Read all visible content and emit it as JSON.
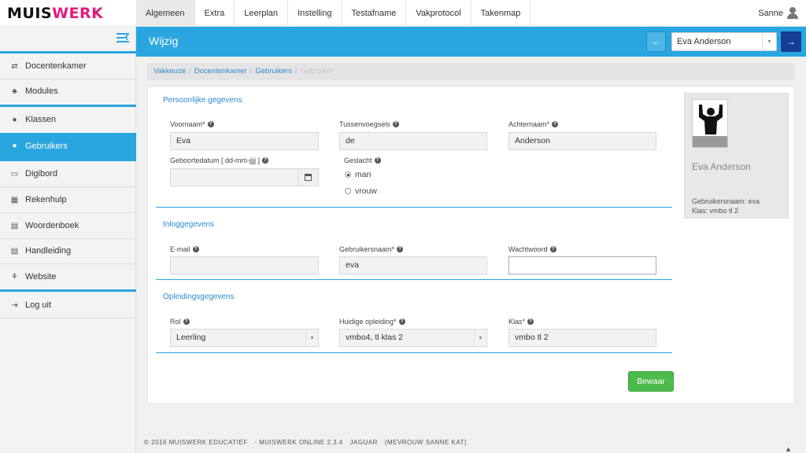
{
  "brand": {
    "logo_main": "MUIS",
    "logo_accent": "WERK"
  },
  "topnav": {
    "tabs": [
      "Algemeen",
      "Extra",
      "Leerplan",
      "Instelling",
      "Testafname",
      "Vakprotocol",
      "Takenmap"
    ],
    "active": "Algemeen",
    "user": "Sanne"
  },
  "sidebar": {
    "items": [
      {
        "label": "Docentenkamer",
        "icon": "transfer-icon"
      },
      {
        "label": "Modules",
        "icon": "puzzle-icon"
      },
      {
        "label": "Klassen",
        "icon": "group-icon"
      },
      {
        "label": "Gebruikers",
        "icon": "user-icon"
      },
      {
        "label": "Digibord",
        "icon": "monitor-icon"
      },
      {
        "label": "Rekenhulp",
        "icon": "calculator-icon"
      },
      {
        "label": "Woordenboek",
        "icon": "book-icon"
      },
      {
        "label": "Handleiding",
        "icon": "manual-icon"
      },
      {
        "label": "Website",
        "icon": "sitemap-icon"
      },
      {
        "label": "Log uit",
        "icon": "logout-icon"
      }
    ],
    "active": "Gebruikers"
  },
  "header": {
    "title": "Wijzig",
    "selected_user": "Eva Anderson"
  },
  "breadcrumb": {
    "items": [
      "Vakkeuze",
      "Docentenkamer",
      "Gebruikers"
    ],
    "current": "Gebruiker"
  },
  "sections": {
    "personal": "Persoonlijke gegevens",
    "login": "Inloggegevens",
    "education": "Opleidingsgegevens"
  },
  "fields": {
    "voornaam": {
      "label": "Voornaam*",
      "value": "Eva"
    },
    "tussenvoegsels": {
      "label": "Tussenvoegsels",
      "value": "de"
    },
    "achternaam": {
      "label": "Achternaam*",
      "value": "Anderson"
    },
    "geboortedatum": {
      "label": "Geboortedatum [ dd-mm-jjjj ]",
      "value": ""
    },
    "geslacht": {
      "label": "Geslacht",
      "options": [
        "man",
        "vrouw"
      ],
      "selected": "man"
    },
    "email": {
      "label": "E-mail",
      "value": ""
    },
    "gebruikersnaam": {
      "label": "Gebruikersnaam*",
      "value": "eva"
    },
    "wachtwoord": {
      "label": "Wachtwoord",
      "value": ""
    },
    "rol": {
      "label": "Rol",
      "value": "Leerling"
    },
    "opleiding": {
      "label": "Huidige opleiding*",
      "value": "vmbo4, tl klas 2"
    },
    "klas": {
      "label": "Klas*",
      "value": "vmbo tl 2"
    }
  },
  "profile": {
    "name": "Eva Anderson",
    "username_line": "Gebruikersnaam: eva",
    "class_line": "Klas: vmbo tl 2"
  },
  "actions": {
    "save": "Bewaar"
  },
  "footer": {
    "copyright": "© 2016 MUISWERK EDUCATIEF",
    "version": "- MUISWERK ONLINE 2.3.4",
    "release": "JAGUAR",
    "user": "(MEVROUW SANNE KAT)"
  },
  "colors": {
    "accent": "#29a6e0",
    "brand_pink": "#e5197f",
    "save_green": "#4cbb4c",
    "nav_dark": "#143d93"
  }
}
